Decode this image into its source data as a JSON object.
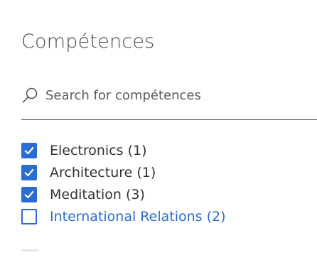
{
  "panel": {
    "title": "Compétences"
  },
  "search": {
    "placeholder": "Search for compétences",
    "value": "",
    "icon": "search-icon"
  },
  "filters": [
    {
      "label": "Electronics (1)",
      "checked": true
    },
    {
      "label": "Architecture (1)",
      "checked": true
    },
    {
      "label": "Meditation (3)",
      "checked": true
    },
    {
      "label": "International Relations (2)",
      "checked": false
    }
  ],
  "colors": {
    "accent": "#2a6bd4",
    "text": "#333333",
    "divider": "#555555"
  }
}
